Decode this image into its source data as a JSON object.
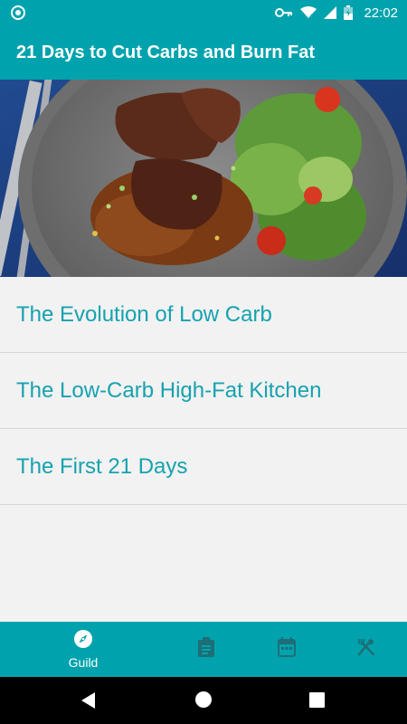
{
  "status_bar": {
    "time": "22:02",
    "icons": [
      "notification-dot-icon",
      "key-icon",
      "wifi-icon",
      "signal-icon",
      "battery-icon"
    ]
  },
  "app_bar": {
    "title": "21 Days to Cut Carbs and Burn Fat"
  },
  "hero": {
    "image_icon": "food-plate-image"
  },
  "list": {
    "items": [
      {
        "label": "The Evolution of Low Carb"
      },
      {
        "label": "The Low-Carb High-Fat Kitchen"
      },
      {
        "label": "The First 21 Days"
      }
    ]
  },
  "bottom_nav": {
    "items": [
      {
        "label": "Guild",
        "icon": "compass-icon",
        "active": true
      },
      {
        "label": "",
        "icon": "clipboard-icon",
        "active": false
      },
      {
        "label": "",
        "icon": "calendar-icon",
        "active": false
      },
      {
        "label": "",
        "icon": "fork-knife-icon",
        "active": false
      }
    ]
  },
  "colors": {
    "primary": "#00a3ad",
    "list_text": "#16a2b0",
    "background": "#f2f2f2",
    "divider": "#d6d6d6"
  }
}
